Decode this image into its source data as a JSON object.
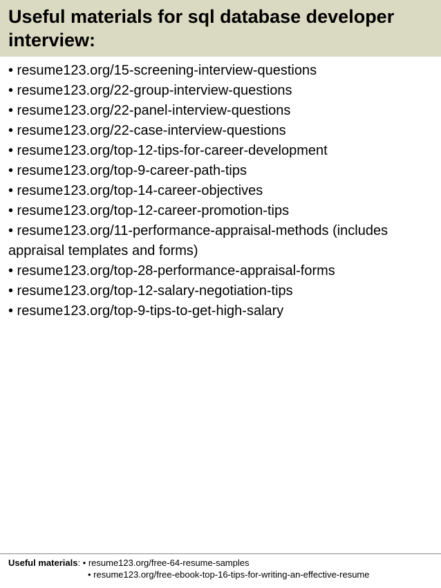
{
  "header": {
    "title": "Useful materials for sql database developer interview:"
  },
  "content": {
    "items": [
      "• resume123.org/15-screening-interview-questions",
      "• resume123.org/22-group-interview-questions",
      "• resume123.org/22-panel-interview-questions",
      "• resume123.org/22-case-interview-questions",
      "• resume123.org/top-12-tips-for-career-development",
      "• resume123.org/top-9-career-path-tips",
      "• resume123.org/top-14-career-objectives",
      "• resume123.org/top-12-career-promotion-tips",
      "• resume123.org/11-performance-appraisal-methods (includes appraisal templates and forms)",
      "• resume123.org/top-28-performance-appraisal-forms",
      "• resume123.org/top-12-salary-negotiation-tips",
      "• resume123.org/top-9-tips-to-get-high-salary"
    ]
  },
  "footer": {
    "label": "Useful materials",
    "line1": ": • resume123.org/free-64-resume-samples",
    "line2": "• resume123.org/free-ebook-top-16-tips-for-writing-an-effective-resume"
  }
}
